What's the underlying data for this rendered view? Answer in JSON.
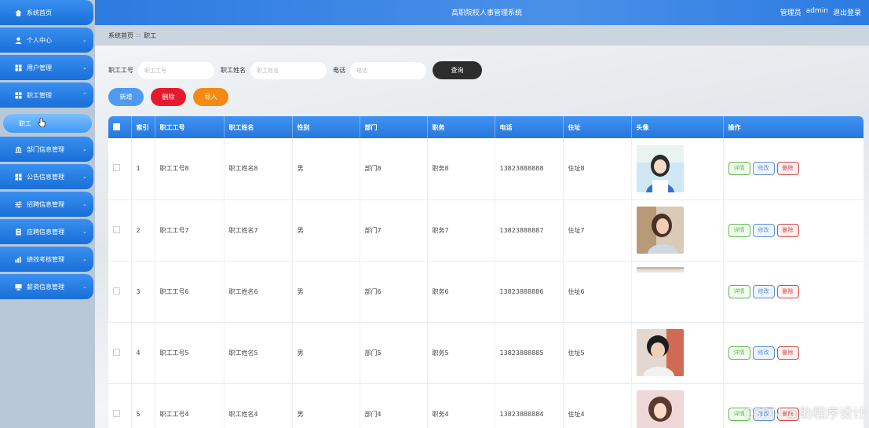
{
  "app": {
    "title": "高职院校人事管理系统"
  },
  "header": {
    "user_role": "管理员",
    "user_name": "admin",
    "logout_label": "退出登录"
  },
  "sidebar": {
    "items": [
      {
        "label": "系统首页",
        "icon": "home-icon",
        "expandable": false
      },
      {
        "label": "个人中心",
        "icon": "user-icon",
        "expandable": true
      },
      {
        "label": "用户管理",
        "icon": "grid-icon",
        "expandable": true
      },
      {
        "label": "职工管理",
        "icon": "grid-icon",
        "expandable": true,
        "expanded": true
      },
      {
        "label": "部门信息管理",
        "icon": "bank-icon",
        "expandable": true
      },
      {
        "label": "公告信息管理",
        "icon": "grid-icon",
        "expandable": true
      },
      {
        "label": "招聘信息管理",
        "icon": "sliders-icon",
        "expandable": true
      },
      {
        "label": "应聘信息管理",
        "icon": "document-icon",
        "expandable": true
      },
      {
        "label": "绩效考核管理",
        "icon": "chart-icon",
        "expandable": true
      },
      {
        "label": "薪资信息管理",
        "icon": "monitor-icon",
        "expandable": true
      }
    ],
    "active_submenu": "职工"
  },
  "breadcrumb": {
    "home": "系统首页",
    "separator": "∷",
    "current": "职工"
  },
  "search": {
    "fields": [
      {
        "label": "职工工号",
        "placeholder": "职工工号"
      },
      {
        "label": "职工姓名",
        "placeholder": "职工姓名"
      },
      {
        "label": "电话",
        "placeholder": "电话"
      }
    ],
    "button": "查询"
  },
  "actions": {
    "add": "新增",
    "delete": "删除",
    "import": "导入"
  },
  "colors": {
    "add": "#4f9bf2",
    "delete": "#e8192c",
    "import": "#f38b13",
    "header": "#2c7be0"
  },
  "table": {
    "columns": [
      "索引",
      "职工工号",
      "职工姓名",
      "性别",
      "部门",
      "职务",
      "电话",
      "住址",
      "头像",
      "操作"
    ],
    "operations": {
      "detail": "详情",
      "edit": "修改",
      "delete": "删除"
    },
    "rows": [
      {
        "index": "1",
        "emp_no": "职工工号8",
        "name": "职工姓名8",
        "gender": "男",
        "dept": "部门8",
        "position": "职务8",
        "phone": "13823888888",
        "address": "住址8",
        "avatar": "photo-girl-blue"
      },
      {
        "index": "2",
        "emp_no": "职工工号7",
        "name": "职工姓名7",
        "gender": "男",
        "dept": "部门7",
        "position": "职务7",
        "phone": "13823888887",
        "address": "住址7",
        "avatar": "photo-girl-street"
      },
      {
        "index": "3",
        "emp_no": "职工工号6",
        "name": "职工姓名6",
        "gender": "男",
        "dept": "部门6",
        "position": "职务6",
        "phone": "13823888886",
        "address": "住址6",
        "avatar": "photo-missing"
      },
      {
        "index": "4",
        "emp_no": "职工工号5",
        "name": "职工姓名5",
        "gender": "男",
        "dept": "部门5",
        "position": "职务5",
        "phone": "13823888885",
        "address": "住址5",
        "avatar": "photo-boy"
      },
      {
        "index": "5",
        "emp_no": "职工工号4",
        "name": "职工姓名4",
        "gender": "男",
        "dept": "部门4",
        "position": "职务4",
        "phone": "13823888884",
        "address": "住址4",
        "avatar": "photo-girl-pink"
      }
    ]
  },
  "watermark": "CSDN @助程序设计"
}
